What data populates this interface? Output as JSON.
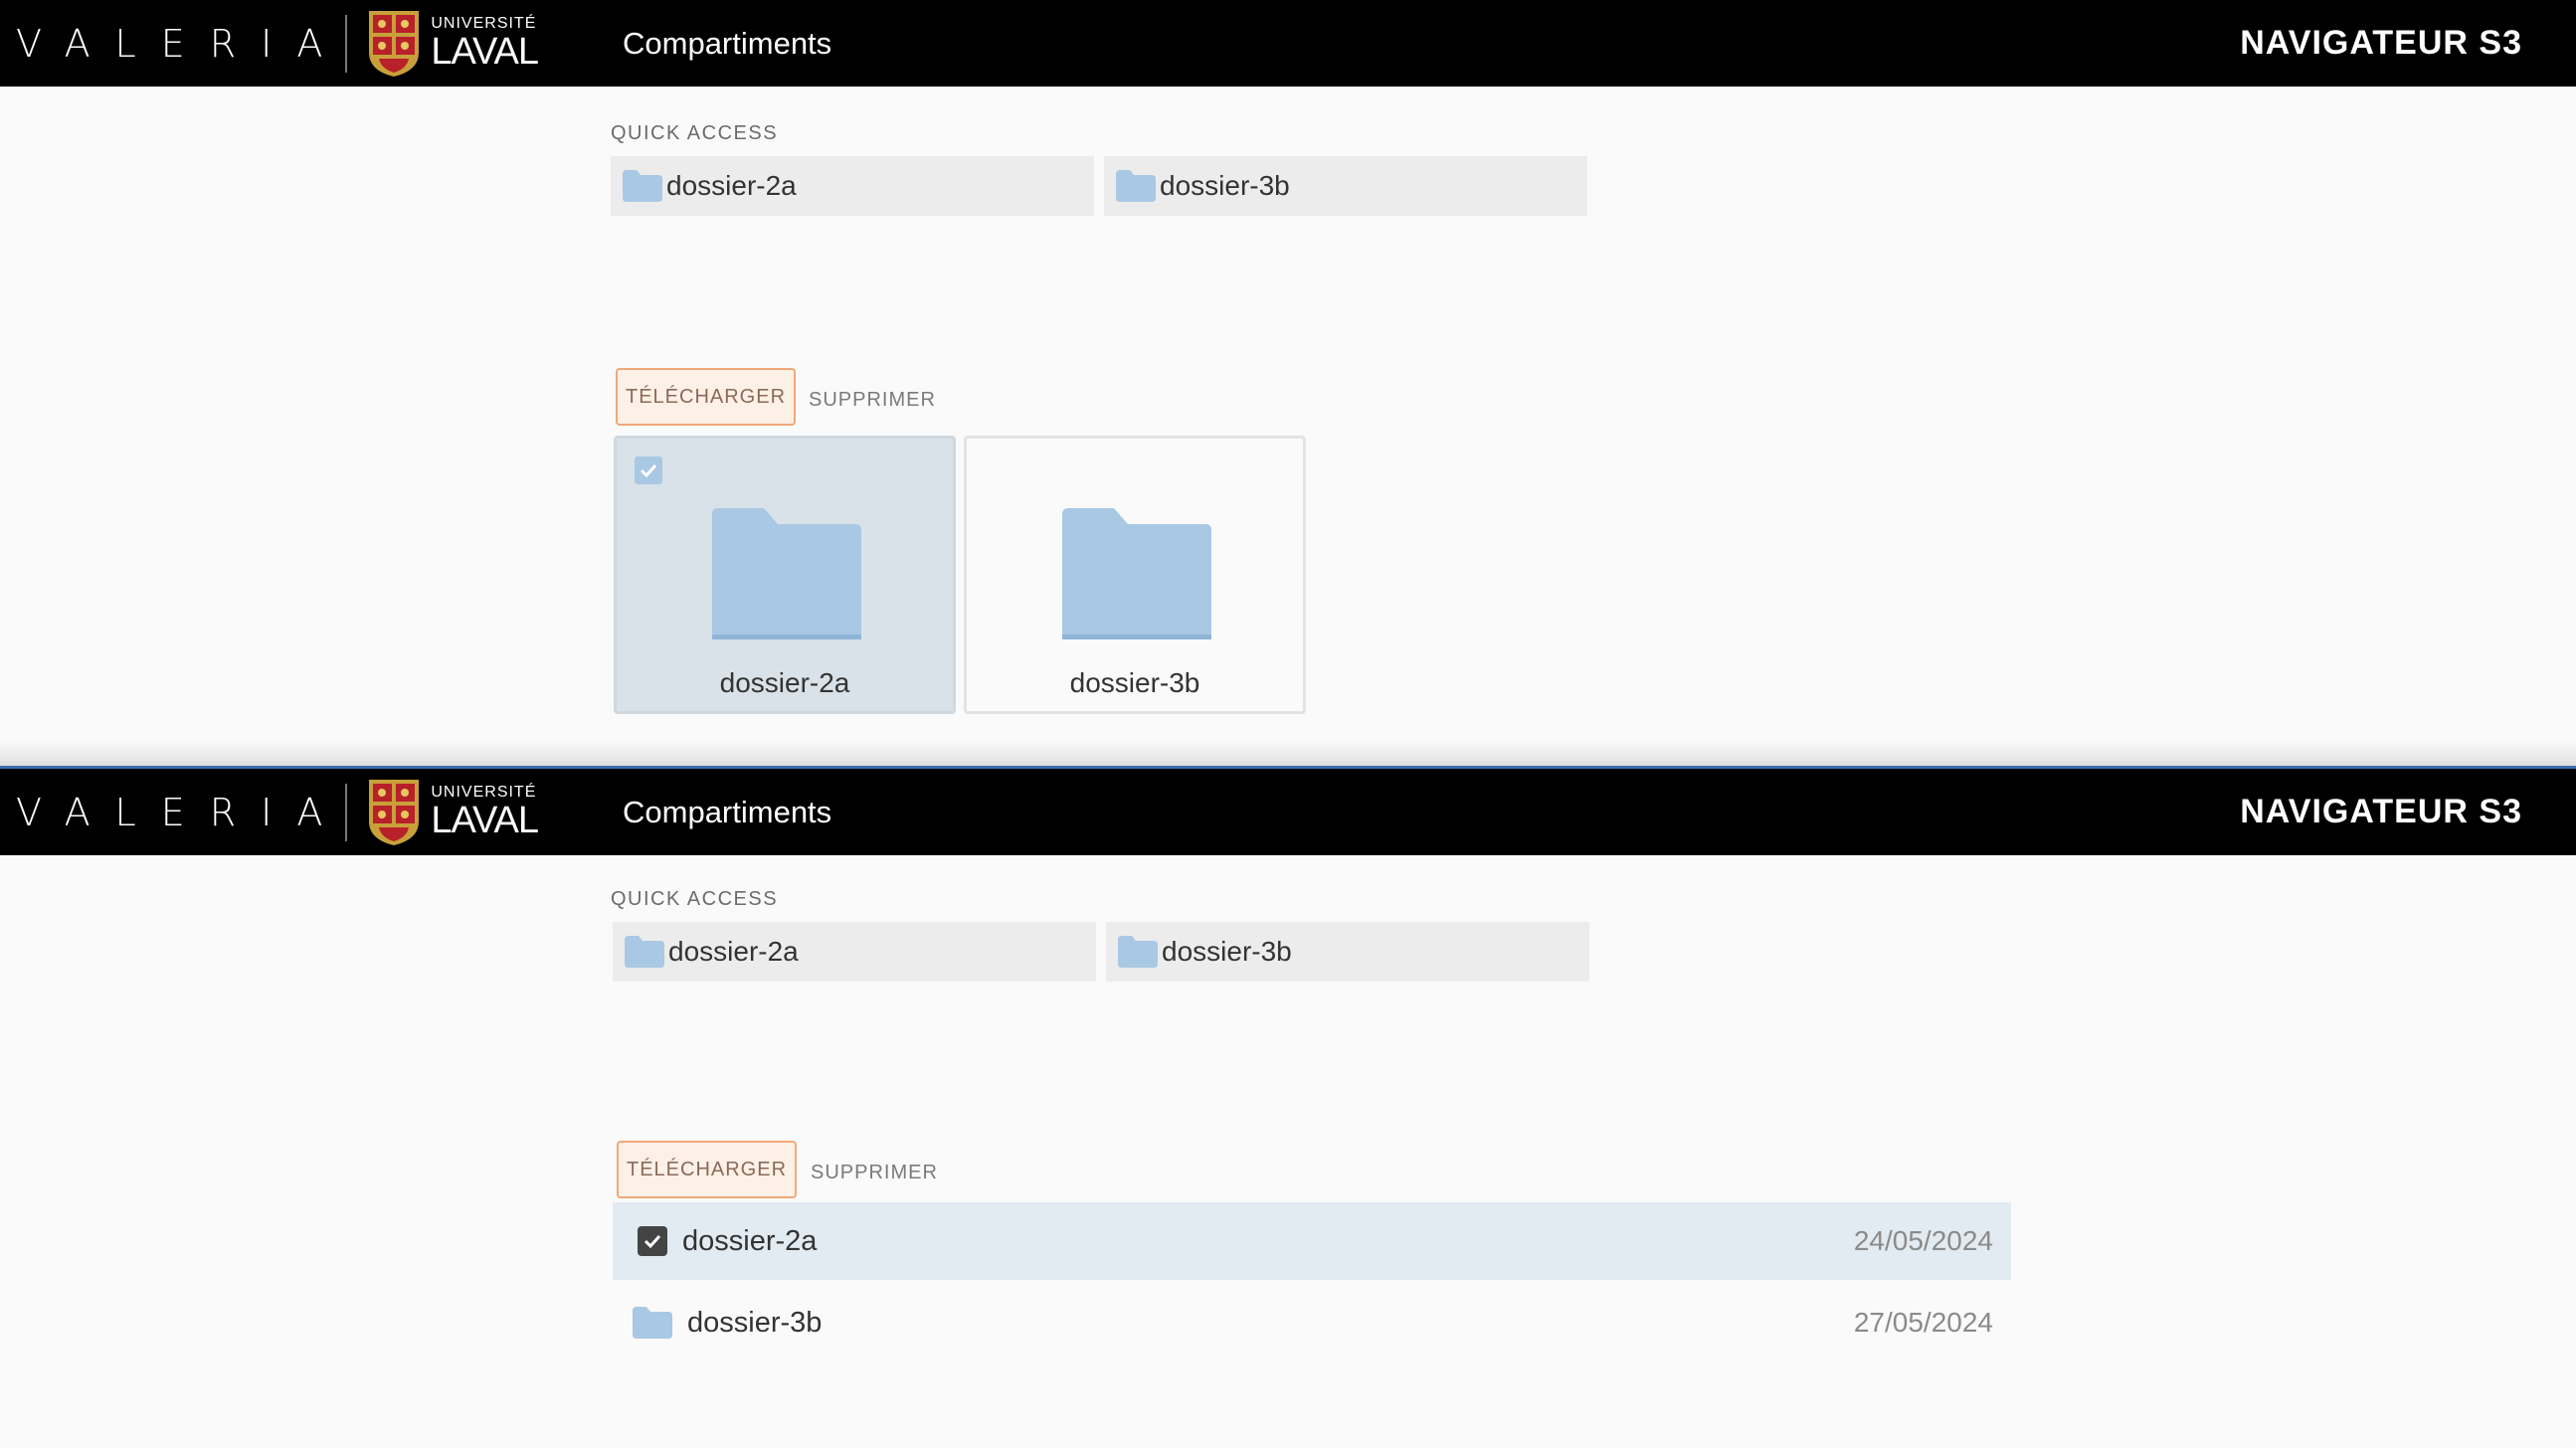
{
  "header": {
    "brand": "VALERIA",
    "university_small": "UNIVERSITÉ",
    "university_big": "LAVAL",
    "nav_title": "Compartiments",
    "app_title": "NAVIGATEUR S3"
  },
  "quick_access": {
    "label": "QUICK ACCESS",
    "items": [
      {
        "name": "dossier-2a",
        "icon": "folder-icon"
      },
      {
        "name": "dossier-3b",
        "icon": "folder-icon"
      }
    ]
  },
  "actions": {
    "download_label": "TÉLÉCHARGER",
    "delete_label": "SUPPRIMER"
  },
  "grid_view": {
    "items": [
      {
        "name": "dossier-2a",
        "selected": true
      },
      {
        "name": "dossier-3b",
        "selected": false
      }
    ]
  },
  "list_view": {
    "items": [
      {
        "name": "dossier-2a",
        "date": "24/05/2024",
        "selected": true
      },
      {
        "name": "dossier-3b",
        "date": "27/05/2024",
        "selected": false
      }
    ]
  },
  "colors": {
    "folder": "#a9c8e4",
    "accent_orange": "#f0a878",
    "selected_bg": "#e2ebf2",
    "header_bg": "#000000"
  }
}
